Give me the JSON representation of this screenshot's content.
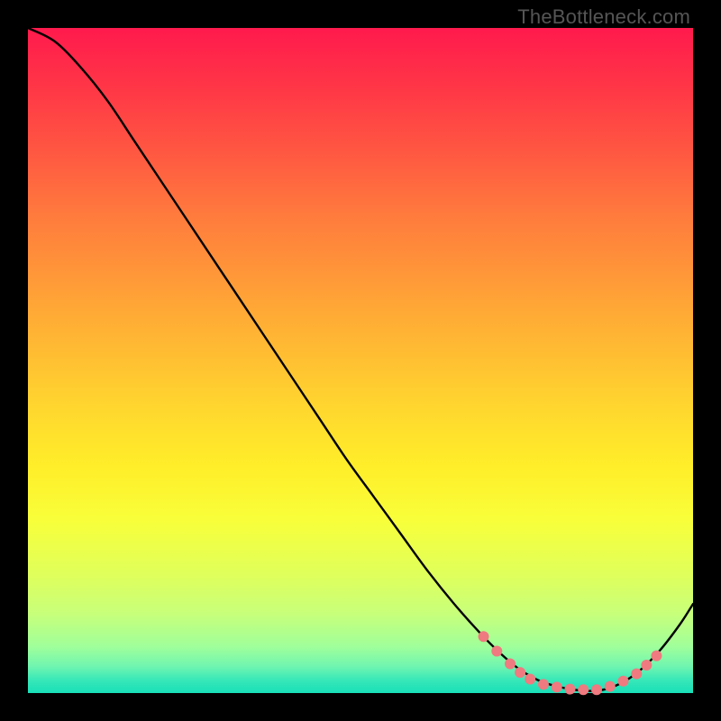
{
  "watermark": "TheBottleneck.com",
  "chart_data": {
    "type": "line",
    "title": "",
    "xlabel": "",
    "ylabel": "",
    "xlim": [
      0,
      100
    ],
    "ylim": [
      0,
      100
    ],
    "grid": false,
    "legend": false,
    "series": [
      {
        "name": "curve",
        "x": [
          0,
          4,
          8,
          12,
          16,
          20,
          24,
          28,
          32,
          36,
          40,
          44,
          48,
          52,
          56,
          60,
          64,
          68,
          71,
          74,
          77,
          80,
          83,
          86,
          89,
          92,
          95,
          98,
          100
        ],
        "values": [
          100,
          98,
          94,
          89,
          83,
          77,
          71,
          65,
          59,
          53,
          47,
          41,
          35,
          29.5,
          24,
          18.5,
          13.5,
          9,
          6,
          3.5,
          1.8,
          0.9,
          0.4,
          0.4,
          1.4,
          3.4,
          6.4,
          10.3,
          13.4
        ]
      }
    ],
    "markers": [
      {
        "x": 68.5,
        "y": 8.5
      },
      {
        "x": 70.5,
        "y": 6.3
      },
      {
        "x": 72.5,
        "y": 4.4
      },
      {
        "x": 74.0,
        "y": 3.1
      },
      {
        "x": 75.5,
        "y": 2.1
      },
      {
        "x": 77.5,
        "y": 1.3
      },
      {
        "x": 79.5,
        "y": 0.9
      },
      {
        "x": 81.5,
        "y": 0.6
      },
      {
        "x": 83.5,
        "y": 0.5
      },
      {
        "x": 85.5,
        "y": 0.5
      },
      {
        "x": 87.5,
        "y": 1.0
      },
      {
        "x": 89.5,
        "y": 1.8
      },
      {
        "x": 91.5,
        "y": 2.9
      },
      {
        "x": 93.0,
        "y": 4.2
      },
      {
        "x": 94.5,
        "y": 5.6
      }
    ],
    "marker_color": "#ef7a7f",
    "line_color": "#000000"
  }
}
